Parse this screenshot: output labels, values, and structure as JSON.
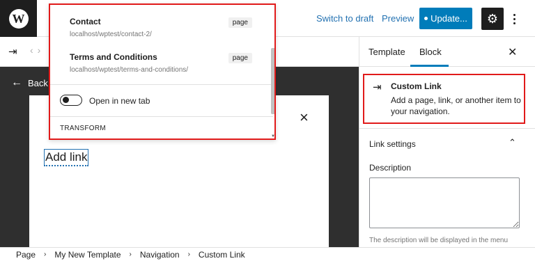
{
  "topbar": {
    "logo_letter": "W",
    "switch_to_draft": "Switch to draft",
    "preview": "Preview",
    "update": "Update...",
    "settings_icon": "gear-icon"
  },
  "canvas": {
    "back_label": "Back",
    "add_link_text": "Add link"
  },
  "popover": {
    "results": [
      {
        "title": "Contact",
        "url": "localhost/wptest/contact-2/",
        "type": "page"
      },
      {
        "title": "Terms and Conditions",
        "url": "localhost/wptest/terms-and-conditions/",
        "type": "page"
      }
    ],
    "open_in_new_tab": "Open in new tab",
    "transform": "TRANSFORM"
  },
  "sidebar": {
    "tabs": [
      "Template",
      "Block"
    ],
    "block": {
      "title": "Custom Link",
      "description": "Add a page, link, or another item to your navigation."
    },
    "link_settings": "Link settings",
    "description_label": "Description",
    "description_help": "The description will be displayed in the menu"
  },
  "breadcrumb": [
    "Page",
    "My New Template",
    "Navigation",
    "Custom Link"
  ],
  "colors": {
    "accent": "#007cba",
    "highlight": "#e11a1a",
    "canvas": "#2f2f2f"
  }
}
